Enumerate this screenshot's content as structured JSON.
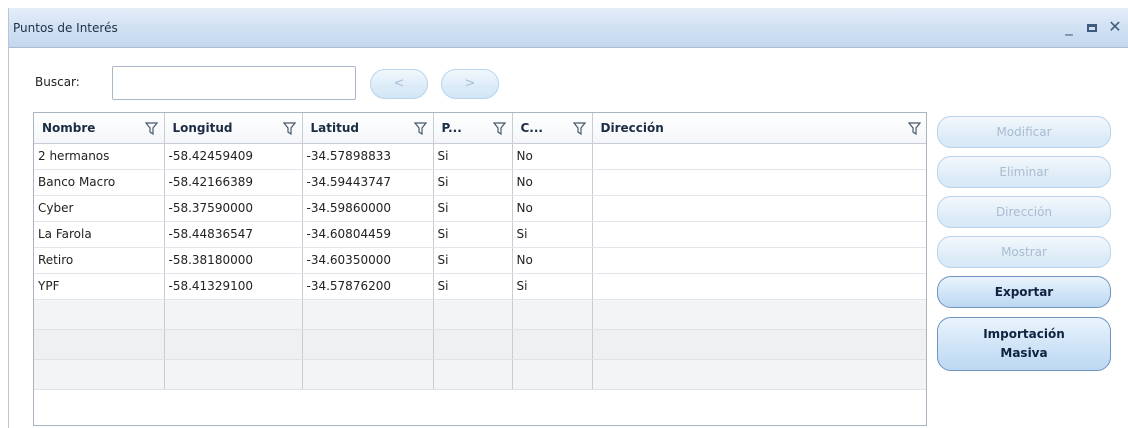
{
  "window": {
    "title": "Puntos de Interés",
    "controls": {
      "minimize": "_",
      "close": "✕"
    }
  },
  "search": {
    "label": "Buscar:",
    "value": "",
    "prev": "<",
    "next": ">"
  },
  "table": {
    "columns": [
      "Nombre",
      "Longitud",
      "Latitud",
      "P...",
      "C...",
      "Dirección"
    ],
    "rows": [
      [
        "2 hermanos",
        "-58.42459409",
        "-34.57898833",
        "Si",
        "No",
        ""
      ],
      [
        "Banco Macro",
        "-58.42166389",
        "-34.59443747",
        "Si",
        "No",
        ""
      ],
      [
        "Cyber",
        "-58.37590000",
        "-34.59860000",
        "Si",
        "No",
        ""
      ],
      [
        "La Farola",
        "-58.44836547",
        "-34.60804459",
        "Si",
        "Si",
        ""
      ],
      [
        "Retiro",
        "-58.38180000",
        "-34.60350000",
        "Si",
        "No",
        ""
      ],
      [
        "YPF",
        "-58.41329100",
        "-34.57876200",
        "Si",
        "Si",
        ""
      ]
    ]
  },
  "actions": {
    "modificar": "Modificar",
    "eliminar": "Eliminar",
    "direccion": "Dirección",
    "mostrar": "Mostrar",
    "exportar": "Exportar",
    "importacion_line1": "Importación",
    "importacion_line2": "Masiva"
  },
  "colors": {
    "titlebar": "#cfe0f2",
    "button_disabled_text": "#a9bcd0",
    "button_enabled_text": "#0f2240"
  }
}
